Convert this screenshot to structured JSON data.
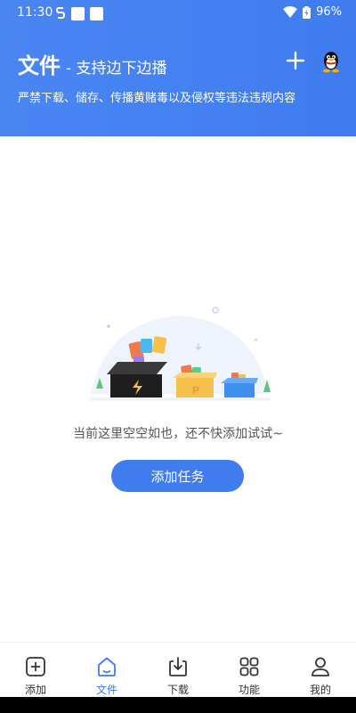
{
  "status_bar": {
    "time": "11:30",
    "battery": "96%"
  },
  "header": {
    "title": "文件",
    "subtitle": "- 支持边下边播",
    "notice": "严禁下载、储存、传播黄赌毒以及侵权等违法违规内容",
    "bg_color": "#4a86f2"
  },
  "empty_state": {
    "message": "当前这里空空如也，还不快添加试试~",
    "button_label": "添加任务"
  },
  "tabbar": {
    "items": [
      {
        "label": "添加",
        "icon": "add-square-icon",
        "active": false
      },
      {
        "label": "文件",
        "icon": "home-icon",
        "active": true
      },
      {
        "label": "下载",
        "icon": "download-icon",
        "active": false
      },
      {
        "label": "功能",
        "icon": "grid-icon",
        "active": false
      },
      {
        "label": "我的",
        "icon": "user-icon",
        "active": false
      }
    ]
  },
  "colors": {
    "accent": "#3f7cf0"
  }
}
